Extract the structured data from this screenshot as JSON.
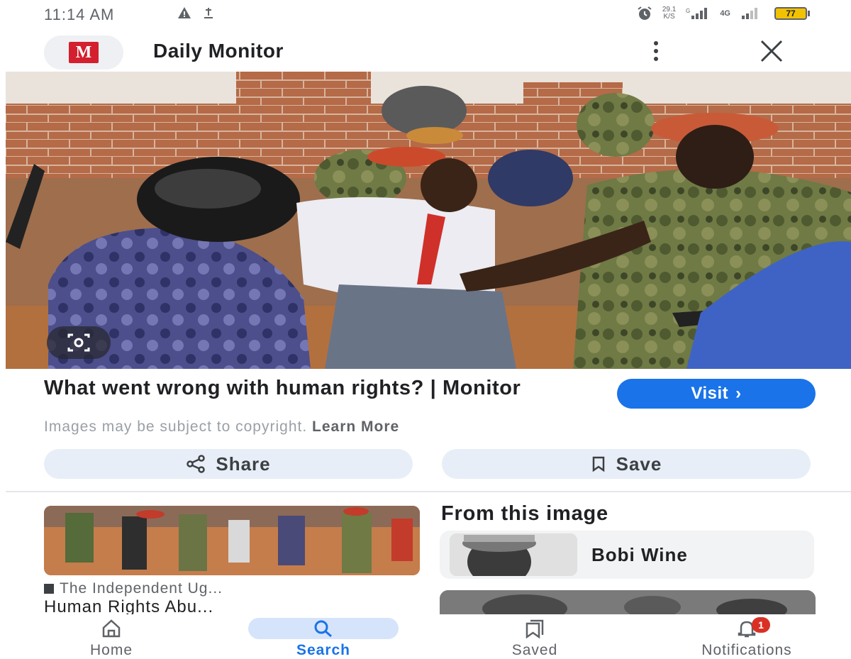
{
  "status_bar": {
    "time": "11:14 AM",
    "network_speed_value": "29.1",
    "network_speed_unit": "K/S",
    "signal_label": "4G",
    "battery": "77"
  },
  "header": {
    "logo_letter": "M",
    "title": "Daily Monitor",
    "logo_color": "#d31f2e"
  },
  "result": {
    "headline": "What went wrong with human rights? | Monitor",
    "visit_label": "Visit",
    "visit_chevron": "›",
    "copyright_text": "Images may be subject to copyright.",
    "learn_more": "Learn More",
    "share_label": "Share",
    "save_label": "Save"
  },
  "related": {
    "source": "The Independent Ug...",
    "title": "Human Rights Abu..."
  },
  "from_image": {
    "heading": "From this image",
    "entity_name": "Bobi Wine"
  },
  "nav": {
    "home": "Home",
    "search": "Search",
    "saved": "Saved",
    "notifications": "Notifications",
    "notification_count": "1"
  },
  "colors": {
    "accent": "#1a73e8",
    "chip_bg": "#e8eef8",
    "badge": "#d93025"
  },
  "icons": {
    "lens": "google-lens-icon",
    "share": "share-icon",
    "save": "bookmark-icon",
    "home": "home-icon",
    "search": "search-icon",
    "saved": "saved-collection-icon",
    "notifications": "bell-icon",
    "close": "close-icon",
    "more": "more-vert-icon"
  }
}
